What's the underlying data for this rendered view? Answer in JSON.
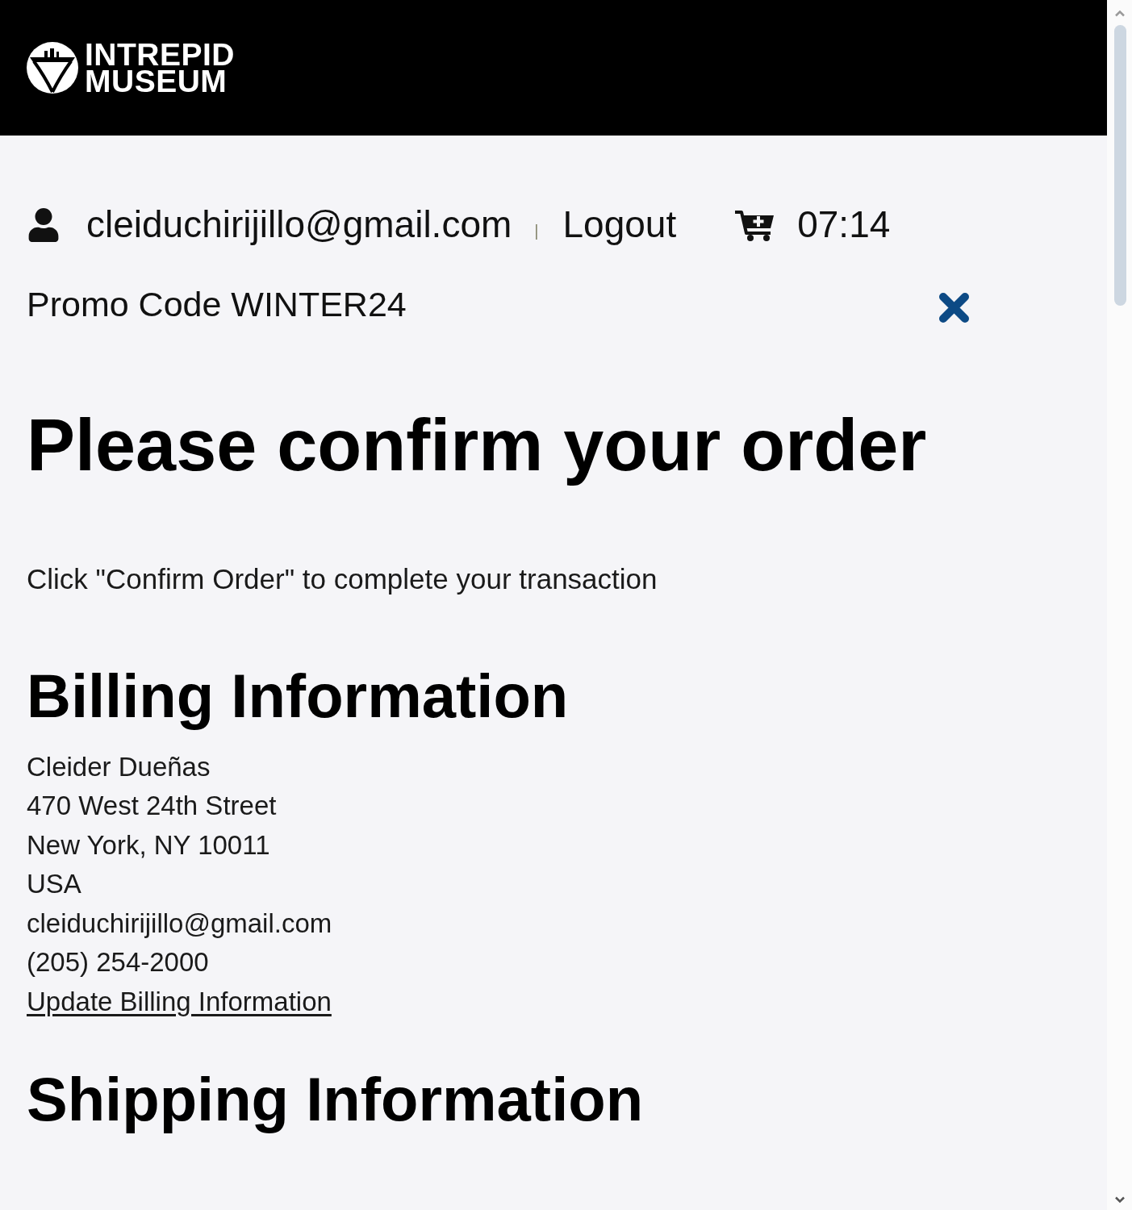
{
  "header": {
    "logo": {
      "lines": [
        "INTREPID",
        "MUSEUM"
      ]
    }
  },
  "account_bar": {
    "email": "cleiduchirijillo@gmail.com",
    "separator": "|",
    "logout": "Logout",
    "timer": "07:14"
  },
  "promo": {
    "text": "Promo Code WINTER24"
  },
  "page_title": "Please confirm your order",
  "instruction": "Click \"Confirm Order\" to complete your transaction",
  "billing": {
    "heading": "Billing Information",
    "lines": [
      "Cleider Dueñas",
      "470 West 24th Street",
      "New York, NY 10011",
      "USA",
      "cleiduchirijillo@gmail.com",
      "(205) 254-2000"
    ],
    "link": "Update Billing Information"
  },
  "shipping": {
    "heading": "Shipping Information"
  }
}
